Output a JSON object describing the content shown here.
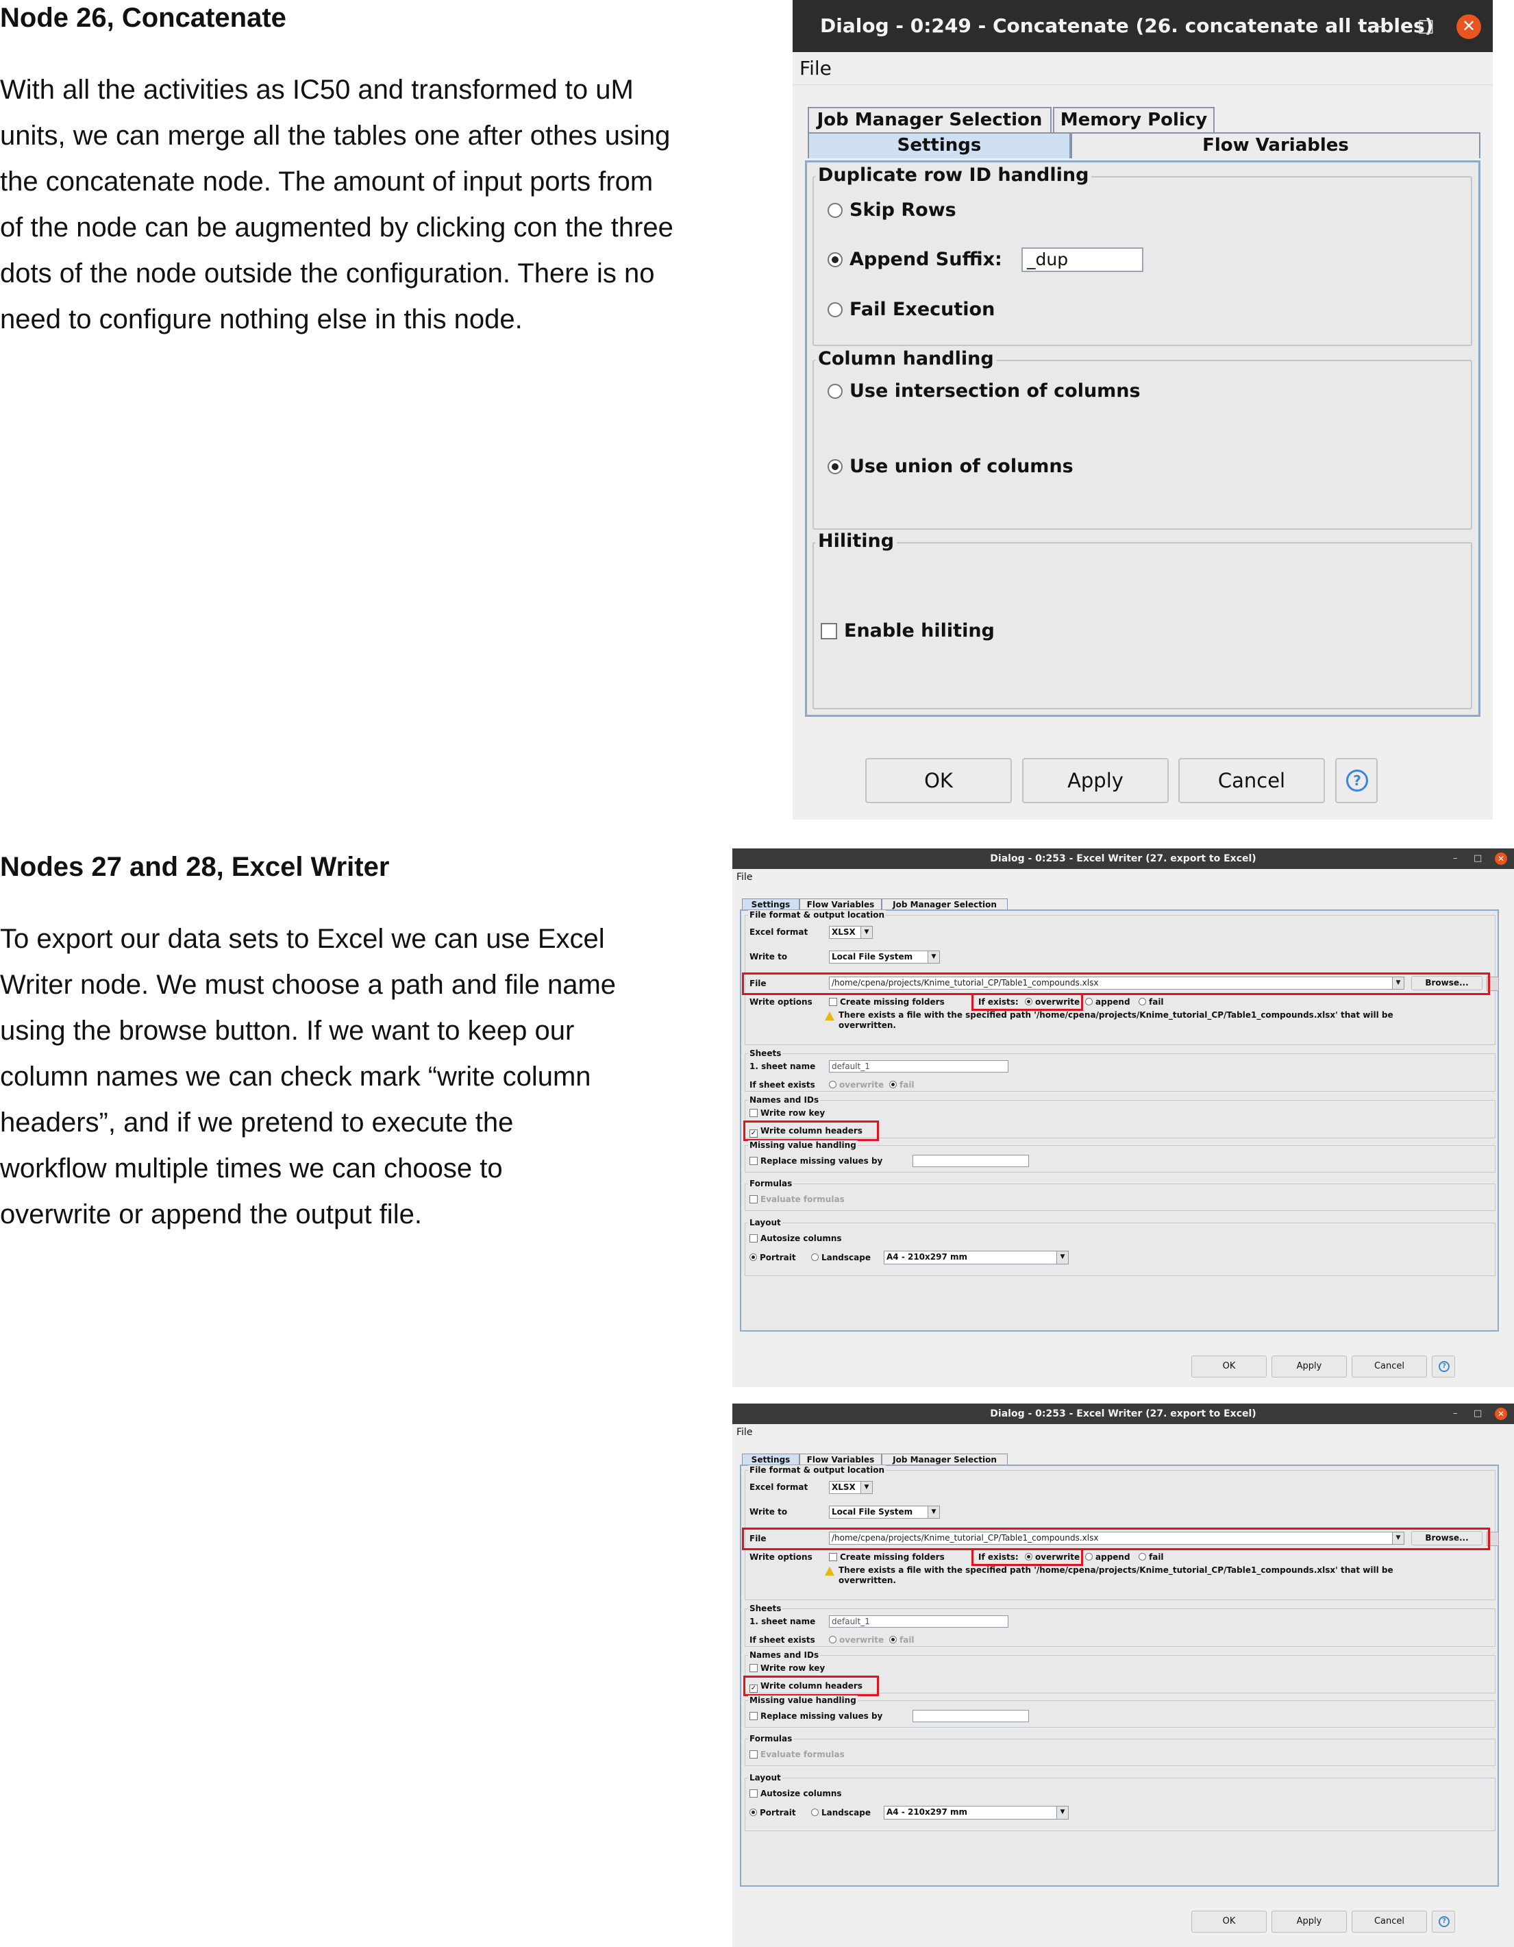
{
  "section1": {
    "heading": "Node 26, Concatenate",
    "lines": [
      "With all the activities as IC50 and transformed to uM",
      "units, we can merge all the tables one after othes using",
      "the concatenate node. The amount of input ports from",
      "of the node can be augmented by clicking con the three",
      "dots of the node outside the configuration. There is no",
      "need to configure nothing else in this node."
    ]
  },
  "section2": {
    "heading": "Nodes 27 and 28, Excel Writer",
    "lines": [
      "To export our data sets to Excel we can use Excel",
      "Writer node. We must choose a path and file name",
      "using the browse button. If we want to keep our",
      "column names we can check mark “write column",
      "headers”, and if we pretend to execute the",
      "workflow multiple times we can choose to",
      "overwrite or append the output file."
    ]
  },
  "concat_dialog": {
    "title": "Dialog - 0:249 - Concatenate (26. concatenate all tables)",
    "minimize": "–",
    "maximize": "□",
    "close": "✕",
    "menu": "File",
    "tabs": [
      "Job Manager Selection",
      "Memory Policy",
      "Settings",
      "Flow Variables"
    ],
    "dup_group": "Duplicate row ID handling",
    "skip_rows": "Skip Rows",
    "append_suffix": "Append Suffix:",
    "suffix_value": "_dup",
    "fail_execution": "Fail Execution",
    "col_group": "Column handling",
    "intersection": "Use intersection of columns",
    "union": "Use union of columns",
    "hilite_group": "Hiliting",
    "enable_hiliting": "Enable hiliting",
    "ok": "OK",
    "apply": "Apply",
    "cancel": "Cancel",
    "help": "?"
  },
  "excel_dialog": {
    "title": "Dialog - 0:253 - Excel Writer (27. export to Excel)",
    "minimize": "–",
    "maximize": "□",
    "close": "✕",
    "menu": "File",
    "tabs": [
      "Settings",
      "Flow Variables",
      "Job Manager Selection"
    ],
    "file_group": "File format & output location",
    "excel_format_label": "Excel format",
    "excel_format_value": "XLSX",
    "write_to_label": "Write to",
    "write_to_value": "Local File System",
    "file_label": "File",
    "file_path": "/home/cpena/projects/Knime_tutorial_CP/Table1_compounds.xlsx",
    "browse": "Browse...",
    "write_options_label": "Write options",
    "create_missing": "Create missing folders",
    "if_exists": "If exists:",
    "overwrite": "overwrite",
    "append": "append",
    "fail": "fail",
    "warning_line1": "There exists a file with the specified path '/home/cpena/projects/Knime_tutorial_CP/Table1_compounds.xlsx' that will be",
    "warning_line2": "overwritten.",
    "sheets_group": "Sheets",
    "sheet_name_label": "1. sheet name",
    "sheet_name_value": "default_1",
    "if_sheet_exists": "If sheet exists",
    "names_group": "Names and IDs",
    "write_row_key": "Write row key",
    "write_col_headers": "Write column headers",
    "missing_group": "Missing value handling",
    "replace_missing": "Replace missing values by",
    "formulas_group": "Formulas",
    "evaluate_formulas": "Evaluate formulas",
    "layout_group": "Layout",
    "autosize": "Autosize columns",
    "portrait": "Portrait",
    "landscape": "Landscape",
    "paper_size": "A4 - 210x297 mm",
    "ok": "OK",
    "apply": "Apply",
    "cancel": "Cancel",
    "help": "?",
    "check_mark": "✓",
    "dropdown_arrow": "▼"
  }
}
